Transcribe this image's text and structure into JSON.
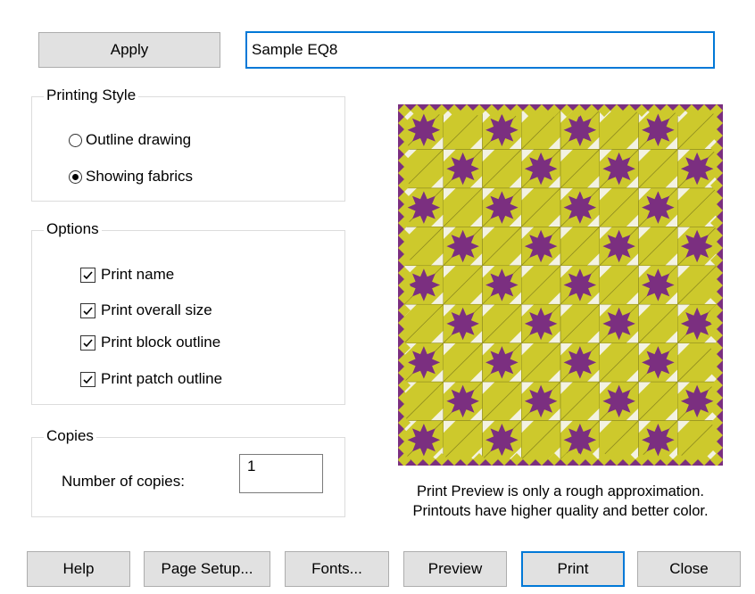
{
  "apply_button": "Apply",
  "name_field": {
    "value": "Sample EQ8"
  },
  "printing_style": {
    "title": "Printing Style",
    "options": [
      "Outline drawing",
      "Showing fabrics"
    ],
    "selected": "Showing fabrics"
  },
  "options_group": {
    "title": "Options",
    "checkboxes": [
      {
        "label": "Print name",
        "checked": true
      },
      {
        "label": "Print overall size",
        "checked": true
      },
      {
        "label": "Print block outline",
        "checked": true
      },
      {
        "label": "Print patch outline",
        "checked": true
      }
    ]
  },
  "copies_group": {
    "title": "Copies",
    "label": "Number of copies:",
    "value": "1"
  },
  "preview": {
    "note_line1": "Print Preview is only a rough approximation.",
    "note_line2": "Printouts have higher quality and better color.",
    "colors": {
      "yellow": "#cdc92c",
      "purple": "#7b2f80",
      "light": "#f3f2e2",
      "olive": "#8f8b1f"
    }
  },
  "buttons": {
    "help": "Help",
    "page_setup": "Page Setup...",
    "fonts": "Fonts...",
    "preview": "Preview",
    "print": "Print",
    "close": "Close"
  },
  "colors": {
    "accent": "#0078d7",
    "button_bg": "#e1e1e1"
  }
}
